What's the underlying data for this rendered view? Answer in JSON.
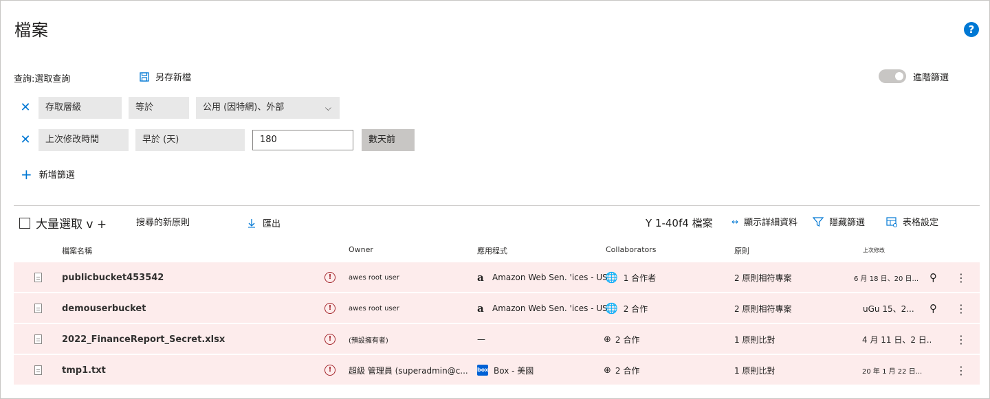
{
  "page": {
    "title": "檔案",
    "help": "?"
  },
  "query": {
    "label": "查詢:選取查詢",
    "save_as": "另存新檔",
    "advanced_filter": "進階篩選"
  },
  "filters": [
    {
      "field": "存取層級",
      "operator": "等於",
      "value": "公用 (因特網)、外部",
      "unit": ""
    },
    {
      "field": "上次修改時間",
      "operator": "早於 (天)",
      "value": "180",
      "unit": "數天前"
    }
  ],
  "add_filter": "新增篩選",
  "toolbar": {
    "bulk_select": "大量選取 v +",
    "new_policy": "搜尋的新原則",
    "export": "匯出",
    "count": "Y 1-40f4 檔案",
    "show_details": "顯示詳細資料",
    "hide_filters": "隱藏篩選",
    "table_settings": "表格設定"
  },
  "columns": [
    "檔案名稱",
    "Owner",
    "應用程式",
    "Collaborators",
    "原則",
    "上次修改"
  ],
  "rows": [
    {
      "name": "publicbucket453542",
      "owner": "awes root user",
      "app": "Amazon Web Sen. 'ices -   US",
      "app_icon": "amazon-icon",
      "collab": "1 合作者",
      "collab_icon": "globe-icon",
      "policy": "2 原則相符專案",
      "modified": "6 月 18 日、20 日...",
      "has_search": true
    },
    {
      "name": "demouserbucket",
      "owner": "awes root user",
      "app": "Amazon Web Sen. 'ices -   US",
      "app_icon": "amazon-icon",
      "collab": "2 合作",
      "collab_icon": "globe-icon",
      "policy": "2 原則相符專案",
      "modified": "uGu 15、2...",
      "has_search": true
    },
    {
      "name": "2022_FinanceReport_Secret.xlsx",
      "owner": "(預設擁有者)",
      "app": "—",
      "app_icon": "",
      "collab": "2 合作",
      "collab_icon": "external-users-icon",
      "policy": "1 原則比對",
      "modified": "4 月 11 日、2 日...",
      "has_search": false
    },
    {
      "name": "tmp1.txt",
      "owner": "超級 管理員 (superadmin@c...",
      "app": "Box - 美國",
      "app_icon": "box-icon",
      "collab": "2 合作",
      "collab_icon": "external-users-icon",
      "policy": "1 原則比對",
      "modified": "20 年 1 月 22 日...",
      "has_search": false
    }
  ],
  "colors": {
    "accent": "#0078d4",
    "row_highlight": "#fdecec",
    "alert": "#a4262c"
  }
}
